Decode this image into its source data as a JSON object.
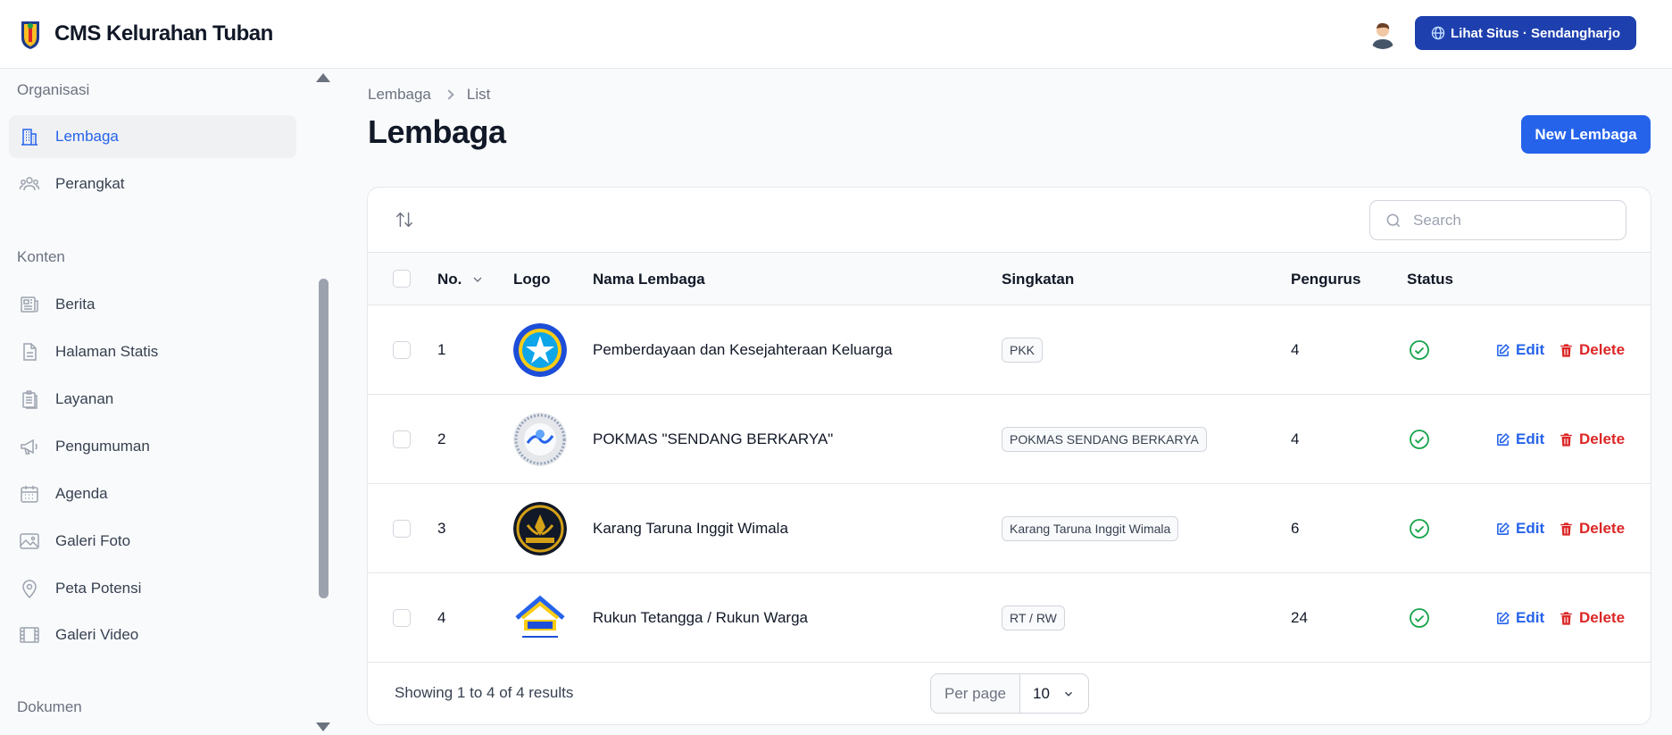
{
  "app": {
    "title": "CMS Kelurahan Tuban"
  },
  "header": {
    "site_button_label": "Lihat Situs · Sendangharjo"
  },
  "sidebar": {
    "groups": [
      {
        "label": "Organisasi"
      },
      {
        "label": "Konten"
      },
      {
        "label": "Dokumen"
      }
    ],
    "items": [
      {
        "label": "Lembaga",
        "icon": "building-icon",
        "active": true
      },
      {
        "label": "Perangkat",
        "icon": "users-icon"
      },
      {
        "label": "Berita",
        "icon": "newspaper-icon"
      },
      {
        "label": "Halaman Statis",
        "icon": "document-icon"
      },
      {
        "label": "Layanan",
        "icon": "clipboard-icon"
      },
      {
        "label": "Pengumuman",
        "icon": "megaphone-icon"
      },
      {
        "label": "Agenda",
        "icon": "calendar-icon"
      },
      {
        "label": "Galeri Foto",
        "icon": "photo-icon"
      },
      {
        "label": "Peta Potensi",
        "icon": "map-pin-icon"
      },
      {
        "label": "Galeri Video",
        "icon": "film-icon"
      }
    ]
  },
  "breadcrumb": {
    "parent": "Lembaga",
    "current": "List"
  },
  "page": {
    "title": "Lembaga",
    "new_button": "New Lembaga"
  },
  "search": {
    "placeholder": "Search"
  },
  "table": {
    "headers": {
      "no": "No.",
      "logo": "Logo",
      "nama": "Nama Lembaga",
      "singkatan": "Singkatan",
      "pengurus": "Pengurus",
      "status": "Status"
    },
    "rows": [
      {
        "no": "1",
        "nama": "Pemberdayaan dan Kesejahteraan Keluarga",
        "singkatan": "PKK",
        "pengurus": "4",
        "status": "active"
      },
      {
        "no": "2",
        "nama": "POKMAS \"SENDANG BERKARYA\"",
        "singkatan": "POKMAS SENDANG BERKARYA",
        "pengurus": "4",
        "status": "active"
      },
      {
        "no": "3",
        "nama": "Karang Taruna Inggit Wimala",
        "singkatan": "Karang Taruna Inggit Wimala",
        "pengurus": "6",
        "status": "active"
      },
      {
        "no": "4",
        "nama": "Rukun Tetangga / Rukun Warga",
        "singkatan": "RT / RW",
        "pengurus": "24",
        "status": "active"
      }
    ],
    "actions": {
      "edit": "Edit",
      "delete": "Delete"
    }
  },
  "pagination": {
    "summary": "Showing 1 to 4 of 4 results",
    "per_page_label": "Per page",
    "per_page_value": "10"
  },
  "colors": {
    "primary": "#2563eb",
    "header_button": "#1e40af",
    "danger": "#dc2626",
    "success": "#16a34a"
  }
}
